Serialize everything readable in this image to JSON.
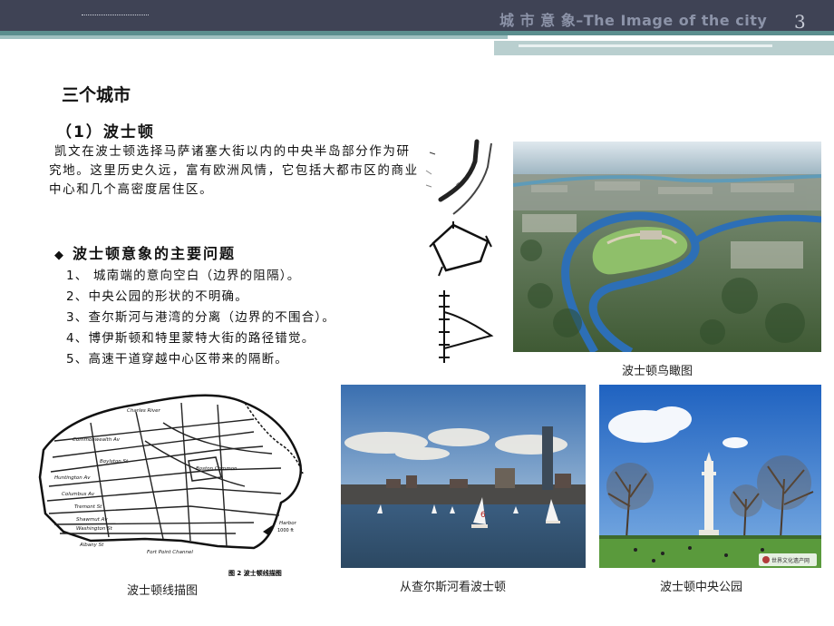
{
  "header": {
    "title": "城 市 意 象–The Image of the city",
    "page_number": "3"
  },
  "content": {
    "main_title": "三个城市",
    "subtitle": "（1）波士顿",
    "intro": "凯文在波士顿选择马萨诸塞大街以内的中央半岛部分作为研究地。这里历史久远，富有欧洲风情，它包括大都市区的商业中心和几个高密度居住区。",
    "issues_heading": "波士顿意象的主要问题",
    "issues": [
      "1、 城南端的意向空白（边界的阻隔）。",
      "2、中央公园的形状的不明确。",
      "3、查尔斯河与港湾的分离（边界的不围合）。",
      "4、博伊斯顿和特里蒙特大街的路径错觉。",
      "5、高速干道穿越中心区带来的隔断。"
    ]
  },
  "figures": {
    "aerial_caption": "波士顿鸟瞰图",
    "line_map_caption": "波士顿线描图",
    "charles_caption": "从查尔斯河看波士顿",
    "common_caption": "波士顿中央公园",
    "map_figure_label": "图 2   波士顿线描图",
    "map_labels": [
      "Charles River",
      "Commonwealth Av",
      "Boylston St",
      "Huntington Av",
      "Columbus Av",
      "Tremont St",
      "Shawmut Av",
      "Washington St",
      "Albany St",
      "Fort Point Channel",
      "Boston Common",
      "Harbor"
    ],
    "watermark": "世界文化遗产网"
  }
}
